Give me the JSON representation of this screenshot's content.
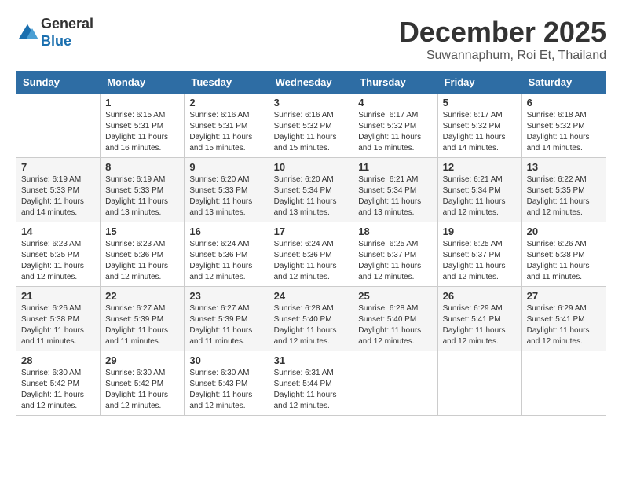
{
  "header": {
    "logo_general": "General",
    "logo_blue": "Blue",
    "month_title": "December 2025",
    "location": "Suwannaphum, Roi Et, Thailand"
  },
  "calendar": {
    "days_of_week": [
      "Sunday",
      "Monday",
      "Tuesday",
      "Wednesday",
      "Thursday",
      "Friday",
      "Saturday"
    ],
    "weeks": [
      [
        {
          "day": "",
          "info": ""
        },
        {
          "day": "1",
          "info": "Sunrise: 6:15 AM\nSunset: 5:31 PM\nDaylight: 11 hours\nand 16 minutes."
        },
        {
          "day": "2",
          "info": "Sunrise: 6:16 AM\nSunset: 5:31 PM\nDaylight: 11 hours\nand 15 minutes."
        },
        {
          "day": "3",
          "info": "Sunrise: 6:16 AM\nSunset: 5:32 PM\nDaylight: 11 hours\nand 15 minutes."
        },
        {
          "day": "4",
          "info": "Sunrise: 6:17 AM\nSunset: 5:32 PM\nDaylight: 11 hours\nand 15 minutes."
        },
        {
          "day": "5",
          "info": "Sunrise: 6:17 AM\nSunset: 5:32 PM\nDaylight: 11 hours\nand 14 minutes."
        },
        {
          "day": "6",
          "info": "Sunrise: 6:18 AM\nSunset: 5:32 PM\nDaylight: 11 hours\nand 14 minutes."
        }
      ],
      [
        {
          "day": "7",
          "info": "Sunrise: 6:19 AM\nSunset: 5:33 PM\nDaylight: 11 hours\nand 14 minutes."
        },
        {
          "day": "8",
          "info": "Sunrise: 6:19 AM\nSunset: 5:33 PM\nDaylight: 11 hours\nand 13 minutes."
        },
        {
          "day": "9",
          "info": "Sunrise: 6:20 AM\nSunset: 5:33 PM\nDaylight: 11 hours\nand 13 minutes."
        },
        {
          "day": "10",
          "info": "Sunrise: 6:20 AM\nSunset: 5:34 PM\nDaylight: 11 hours\nand 13 minutes."
        },
        {
          "day": "11",
          "info": "Sunrise: 6:21 AM\nSunset: 5:34 PM\nDaylight: 11 hours\nand 13 minutes."
        },
        {
          "day": "12",
          "info": "Sunrise: 6:21 AM\nSunset: 5:34 PM\nDaylight: 11 hours\nand 12 minutes."
        },
        {
          "day": "13",
          "info": "Sunrise: 6:22 AM\nSunset: 5:35 PM\nDaylight: 11 hours\nand 12 minutes."
        }
      ],
      [
        {
          "day": "14",
          "info": "Sunrise: 6:23 AM\nSunset: 5:35 PM\nDaylight: 11 hours\nand 12 minutes."
        },
        {
          "day": "15",
          "info": "Sunrise: 6:23 AM\nSunset: 5:36 PM\nDaylight: 11 hours\nand 12 minutes."
        },
        {
          "day": "16",
          "info": "Sunrise: 6:24 AM\nSunset: 5:36 PM\nDaylight: 11 hours\nand 12 minutes."
        },
        {
          "day": "17",
          "info": "Sunrise: 6:24 AM\nSunset: 5:36 PM\nDaylight: 11 hours\nand 12 minutes."
        },
        {
          "day": "18",
          "info": "Sunrise: 6:25 AM\nSunset: 5:37 PM\nDaylight: 11 hours\nand 12 minutes."
        },
        {
          "day": "19",
          "info": "Sunrise: 6:25 AM\nSunset: 5:37 PM\nDaylight: 11 hours\nand 12 minutes."
        },
        {
          "day": "20",
          "info": "Sunrise: 6:26 AM\nSunset: 5:38 PM\nDaylight: 11 hours\nand 11 minutes."
        }
      ],
      [
        {
          "day": "21",
          "info": "Sunrise: 6:26 AM\nSunset: 5:38 PM\nDaylight: 11 hours\nand 11 minutes."
        },
        {
          "day": "22",
          "info": "Sunrise: 6:27 AM\nSunset: 5:39 PM\nDaylight: 11 hours\nand 11 minutes."
        },
        {
          "day": "23",
          "info": "Sunrise: 6:27 AM\nSunset: 5:39 PM\nDaylight: 11 hours\nand 11 minutes."
        },
        {
          "day": "24",
          "info": "Sunrise: 6:28 AM\nSunset: 5:40 PM\nDaylight: 11 hours\nand 12 minutes."
        },
        {
          "day": "25",
          "info": "Sunrise: 6:28 AM\nSunset: 5:40 PM\nDaylight: 11 hours\nand 12 minutes."
        },
        {
          "day": "26",
          "info": "Sunrise: 6:29 AM\nSunset: 5:41 PM\nDaylight: 11 hours\nand 12 minutes."
        },
        {
          "day": "27",
          "info": "Sunrise: 6:29 AM\nSunset: 5:41 PM\nDaylight: 11 hours\nand 12 minutes."
        }
      ],
      [
        {
          "day": "28",
          "info": "Sunrise: 6:30 AM\nSunset: 5:42 PM\nDaylight: 11 hours\nand 12 minutes."
        },
        {
          "day": "29",
          "info": "Sunrise: 6:30 AM\nSunset: 5:42 PM\nDaylight: 11 hours\nand 12 minutes."
        },
        {
          "day": "30",
          "info": "Sunrise: 6:30 AM\nSunset: 5:43 PM\nDaylight: 11 hours\nand 12 minutes."
        },
        {
          "day": "31",
          "info": "Sunrise: 6:31 AM\nSunset: 5:44 PM\nDaylight: 11 hours\nand 12 minutes."
        },
        {
          "day": "",
          "info": ""
        },
        {
          "day": "",
          "info": ""
        },
        {
          "day": "",
          "info": ""
        }
      ]
    ]
  }
}
